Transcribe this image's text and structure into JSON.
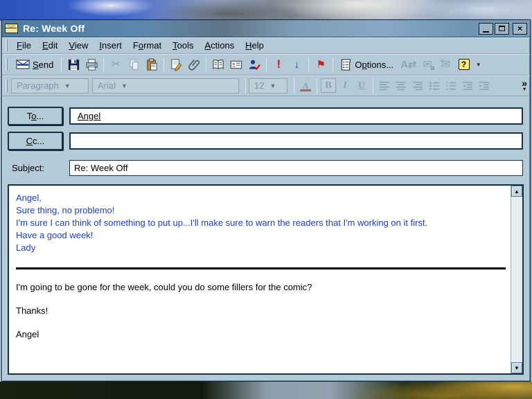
{
  "window": {
    "title": "Re: Week Off",
    "controls": {
      "minimize": "minimize",
      "maximize": "maximize",
      "close": "close"
    }
  },
  "menu": {
    "items": [
      {
        "label": "File",
        "u": 0
      },
      {
        "label": "Edit",
        "u": 0
      },
      {
        "label": "View",
        "u": 0
      },
      {
        "label": "Insert",
        "u": 0
      },
      {
        "label": "Format",
        "u": 1
      },
      {
        "label": "Tools",
        "u": 0
      },
      {
        "label": "Actions",
        "u": 0
      },
      {
        "label": "Help",
        "u": 0
      }
    ]
  },
  "toolbar": {
    "send": {
      "label": "Send",
      "u": 0
    },
    "options": {
      "label": "Options...",
      "u": 1
    },
    "icons": [
      "send-envelope",
      "save",
      "print",
      "cut",
      "copy",
      "paste",
      "signature",
      "attach-file",
      "address-book",
      "business-card",
      "check-names",
      "importance-high",
      "importance-low",
      "flag-for-follow-up",
      "options-list",
      "message-format",
      "encrypt-message",
      "digitally-sign",
      "help",
      "more-buttons"
    ],
    "importance_high_glyph": "!",
    "importance_low_glyph": "↓",
    "flag_glyph": "⚑",
    "help_glyph": "?",
    "more_glyph": "▾"
  },
  "format_toolbar": {
    "style_value": "Paragraph",
    "font_value": "Arial",
    "size_value": "12",
    "bold_glyph": "B",
    "italic_glyph": "I",
    "underline_glyph": "U",
    "fontcolor_glyph": "A",
    "more_chevron": "»",
    "more_arrow": "▾",
    "buttons": [
      "font-color",
      "bold",
      "italic",
      "underline",
      "align-left",
      "align-center",
      "align-right",
      "bullets",
      "numbering",
      "decrease-indent",
      "increase-indent",
      "more"
    ]
  },
  "header": {
    "to_button": {
      "label": "To...",
      "u": 1
    },
    "to_value": "Angel",
    "cc_button": {
      "label": "Cc...",
      "u": 0
    },
    "cc_value": "",
    "subject_label": {
      "label": "Subject:",
      "u": 3
    },
    "subject_value": "Re: Week Off"
  },
  "body": {
    "reply_lines": [
      "Angel,",
      "Sure thing, no problemo!",
      "I'm sure I can think of something to put up...I'll make sure to warn the readers that I'm working on it first.",
      "Have a good week!",
      "Lady"
    ],
    "original_lines": [
      "I'm going to be gone for the week, could you do some fillers for the comic?",
      "",
      "Thanks!",
      "",
      "Angel"
    ]
  },
  "colors": {
    "titlebar": "#5d87ab",
    "chrome": "#b5cad7",
    "disabled": "#8aa4b6",
    "reply_text": "#1c3fc4",
    "original_text": "#000000",
    "importance_high": "#cc1111",
    "importance_low": "#24449e",
    "flag": "#c32222"
  }
}
